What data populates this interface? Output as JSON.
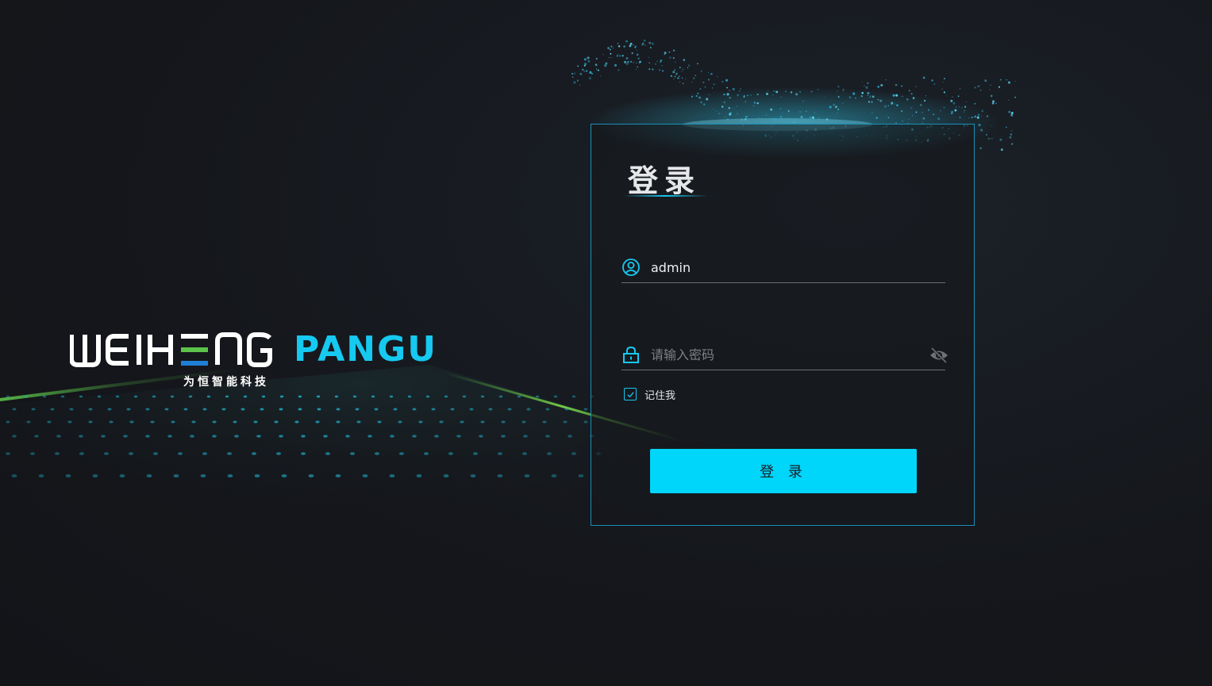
{
  "brand": {
    "logo_text": "WEIHENG",
    "product_name": "PANGU",
    "subtitle": "为恒智能科技"
  },
  "login": {
    "title": "登录",
    "username": {
      "value": "admin",
      "icon": "user-circle-icon"
    },
    "password": {
      "value": "",
      "placeholder": "请输入密码",
      "icon": "lock-icon",
      "toggle_icon": "eye-off-icon"
    },
    "remember_me": {
      "label": "记住我",
      "checked": true
    },
    "submit_label": "登 录"
  },
  "colors": {
    "accent": "#16c9f0",
    "button": "#00d5fa",
    "background": "#15171c",
    "logo_green": "#5cc34a",
    "logo_blue": "#1f7fd6"
  }
}
